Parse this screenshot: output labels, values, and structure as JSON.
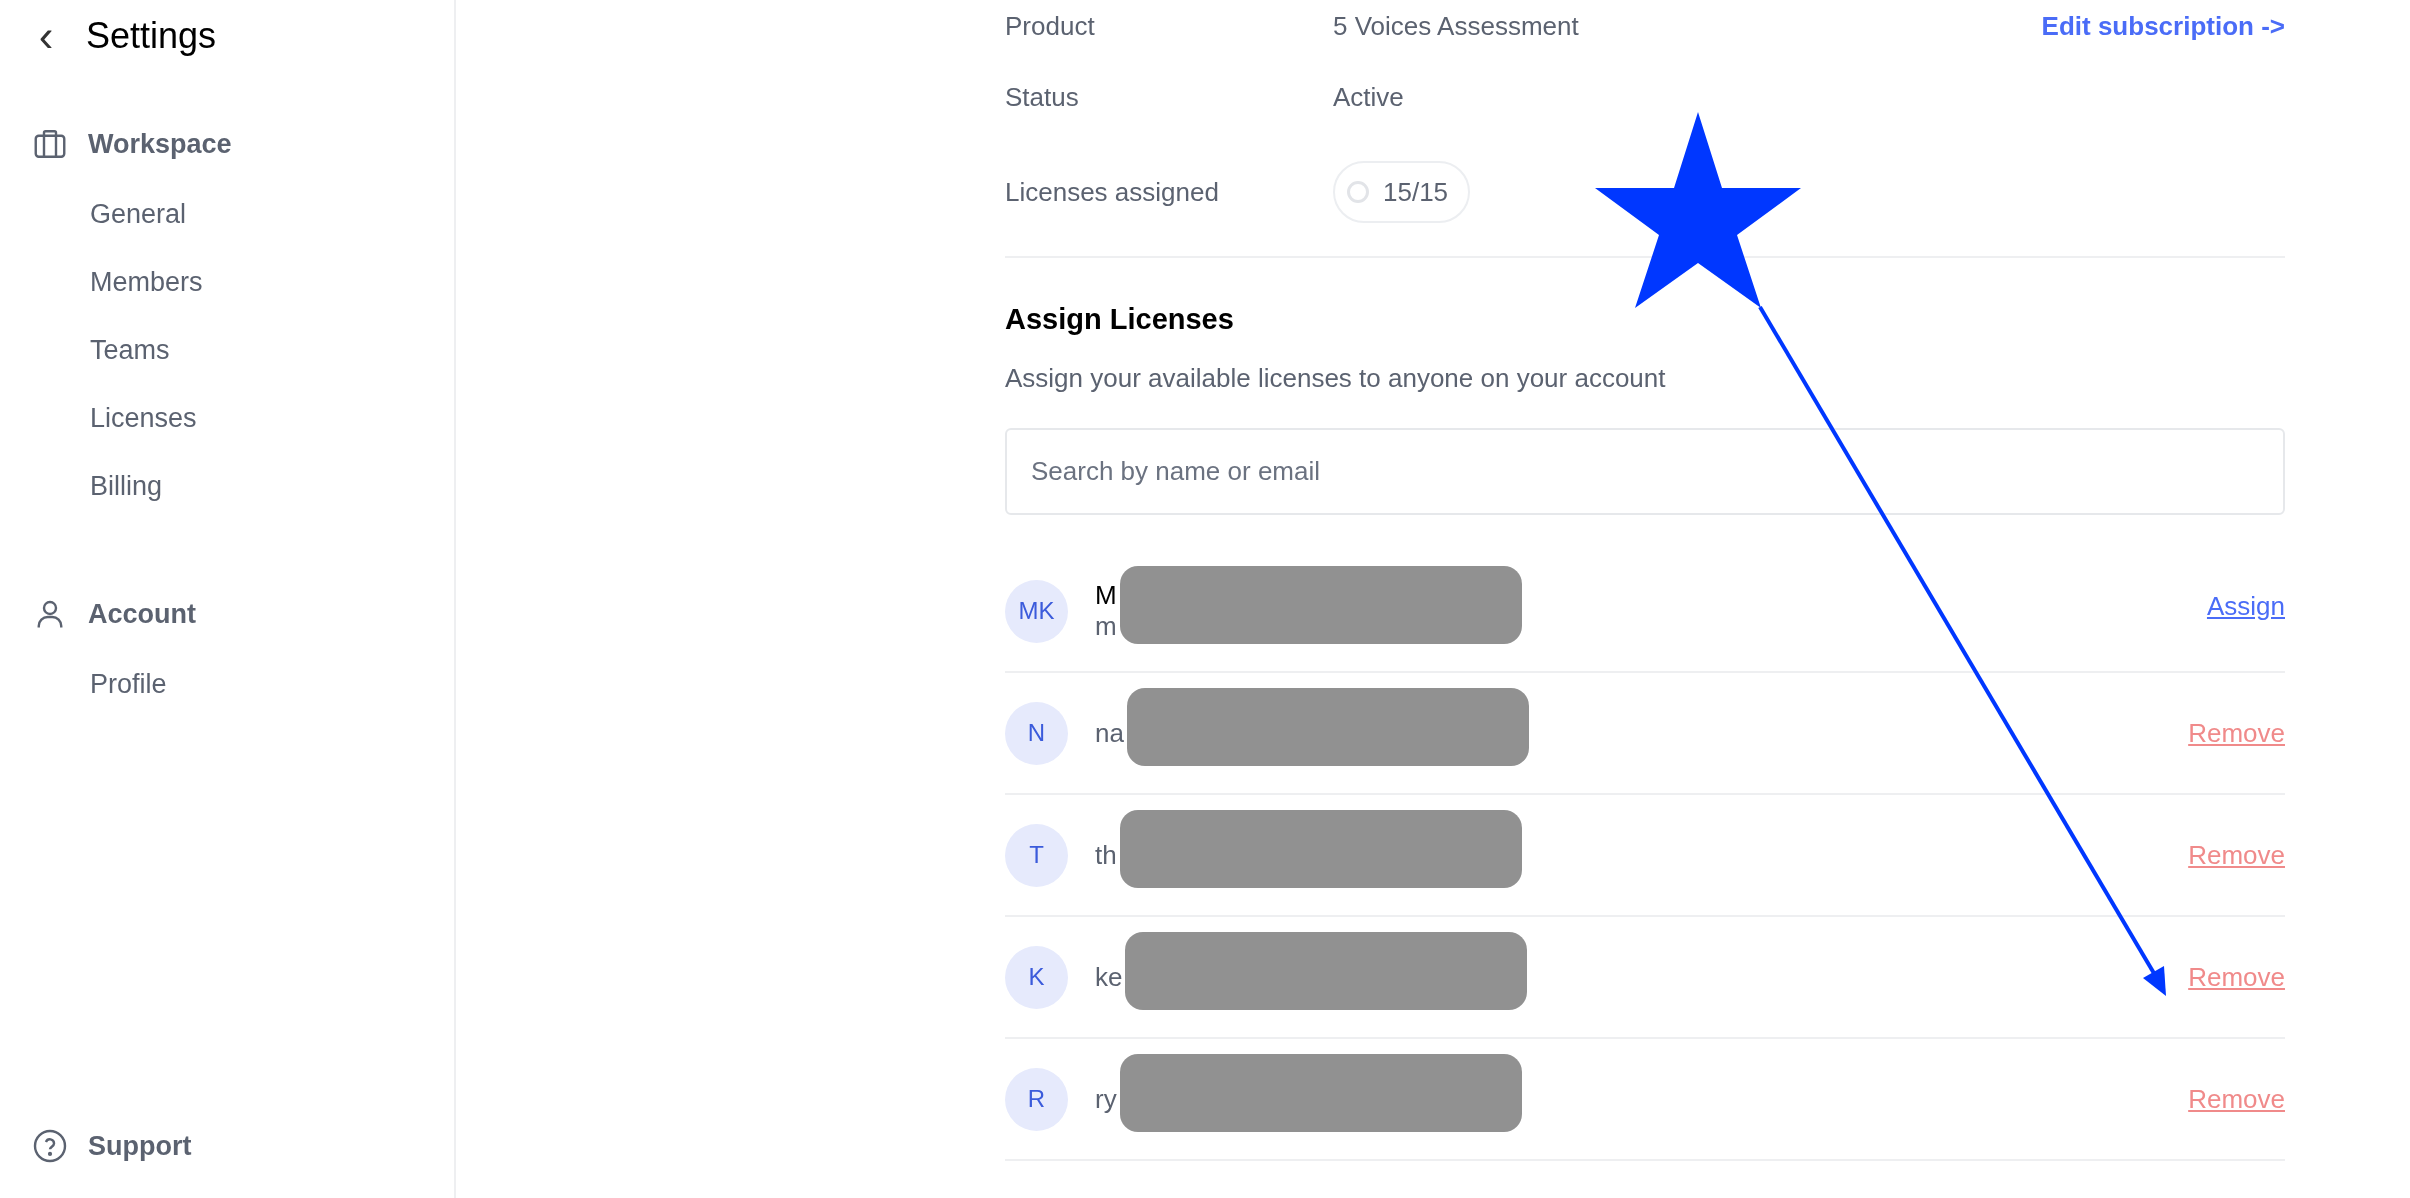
{
  "sidebar": {
    "back_icon": "‹",
    "title": "Settings",
    "sections": [
      {
        "kind": "workspace",
        "heading": "Workspace",
        "items": [
          {
            "label": "General",
            "selected": false
          },
          {
            "label": "Members",
            "selected": false
          },
          {
            "label": "Teams",
            "selected": false
          },
          {
            "label": "Licenses",
            "selected": false
          },
          {
            "label": "Billing",
            "selected": false
          }
        ]
      },
      {
        "kind": "account",
        "heading": "Account",
        "items": [
          {
            "label": "Profile",
            "selected": false
          }
        ]
      }
    ],
    "support": "Support"
  },
  "subscription": {
    "rows": [
      {
        "label": "Product",
        "value": "5 Voices Assessment",
        "kind": "text"
      },
      {
        "label": "Status",
        "value": "Active",
        "kind": "text"
      },
      {
        "label": "Licenses assigned",
        "value": "15/15",
        "kind": "pill"
      }
    ],
    "edit_link": "Edit subscription ->"
  },
  "assign": {
    "title": "Assign Licenses",
    "subtitle": "Assign your available licenses to anyone on your account",
    "search": {
      "placeholder": "Search by name or email"
    },
    "members": [
      {
        "initials": "MK",
        "name": "M",
        "email": "m",
        "kind": "unassigned",
        "action": "Assign"
      },
      {
        "initials": "N",
        "name": "na",
        "kind": "assigned",
        "action": "Remove"
      },
      {
        "initials": "T",
        "name": "th",
        "kind": "assigned",
        "action": "Remove"
      },
      {
        "initials": "K",
        "name": "ke",
        "kind": "assigned",
        "action": "Remove"
      },
      {
        "initials": "R",
        "name": "ry",
        "kind": "assigned",
        "action": "Remove"
      }
    ]
  }
}
